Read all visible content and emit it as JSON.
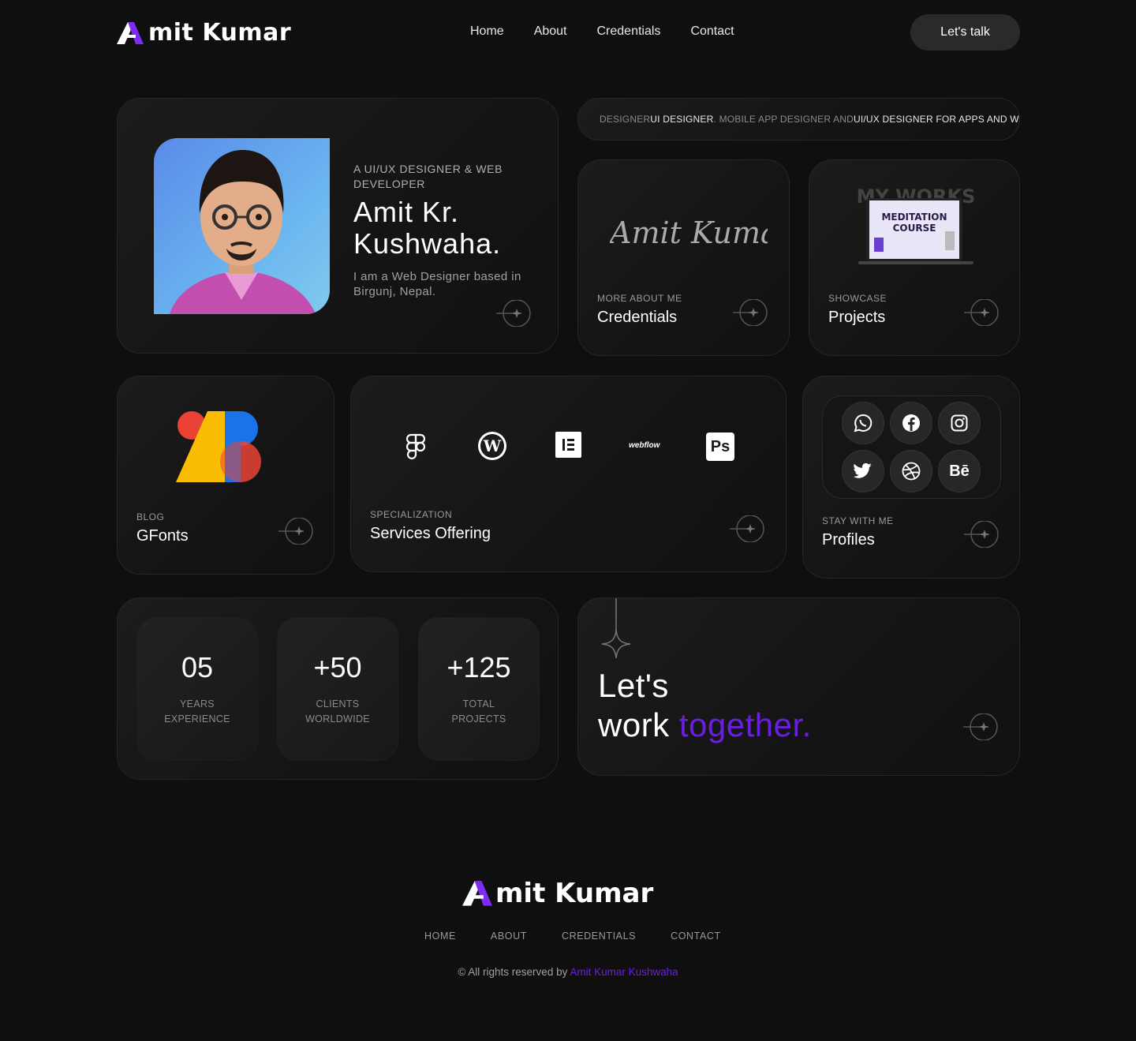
{
  "header": {
    "logo_text": "mit Kumar",
    "logo_initial": "A",
    "nav": [
      "Home",
      "About",
      "Credentials",
      "Contact"
    ],
    "cta": "Let's talk"
  },
  "hero": {
    "role": "A UI/UX DESIGNER & WEB DEVELOPER",
    "name": "Amit Kr. Kushwaha.",
    "description": "I am a Web Designer based in Birgunj, Nepal."
  },
  "marquee": {
    "parts": [
      {
        "text": "DESIGNER ",
        "style": "dim"
      },
      {
        "text": "UI DESIGNER",
        "style": "bright"
      },
      {
        "text": ". MOBILE APP DESIGNER AND ",
        "style": "dim"
      },
      {
        "text": "UI/UX DESIGNER FOR APPS AND W",
        "style": "bright"
      }
    ]
  },
  "cards": {
    "credentials": {
      "sub": "MORE ABOUT ME",
      "title": "Credentials",
      "signature": "Amit Kumar"
    },
    "projects": {
      "sub": "SHOWCASE",
      "title": "Projects",
      "thumb_heading": "MY WORKS",
      "thumb_line1": "MEDITATION",
      "thumb_line2": "COURSE"
    },
    "blog": {
      "sub": "BLOG",
      "title": "GFonts"
    },
    "services": {
      "sub": "SPECIALIZATION",
      "title": "Services Offering",
      "tools": [
        "figma-icon",
        "wordpress-icon",
        "elementor-icon",
        "webflow-icon",
        "photoshop-icon"
      ],
      "webflow_text": "webflow",
      "ps_text": "Ps"
    },
    "profiles": {
      "sub": "STAY WITH ME",
      "title": "Profiles",
      "icons": [
        "whatsapp-icon",
        "facebook-icon",
        "instagram-icon",
        "twitter-icon",
        "dribbble-icon",
        "behance-icon"
      ],
      "behance_text": "Bē"
    }
  },
  "stats": [
    {
      "value": "05",
      "line1": "YEARS",
      "line2": "EXPERIENCE"
    },
    {
      "value": "+50",
      "line1": "CLIENTS",
      "line2": "WORLDWIDE"
    },
    {
      "value": "+125",
      "line1": "TOTAL",
      "line2": "PROJECTS"
    }
  ],
  "work": {
    "line1": "Let's",
    "line2a": "work ",
    "line2b": "together."
  },
  "footer": {
    "nav": [
      "HOME",
      "ABOUT",
      "CREDENTIALS",
      "CONTACT"
    ],
    "copyright_prefix": "© All rights reserved by ",
    "copyright_name": "Amit Kumar Kushwaha"
  },
  "colors": {
    "accent": "#6a1fe0",
    "background": "#0f0f0f",
    "card": "#1a1a1a"
  }
}
